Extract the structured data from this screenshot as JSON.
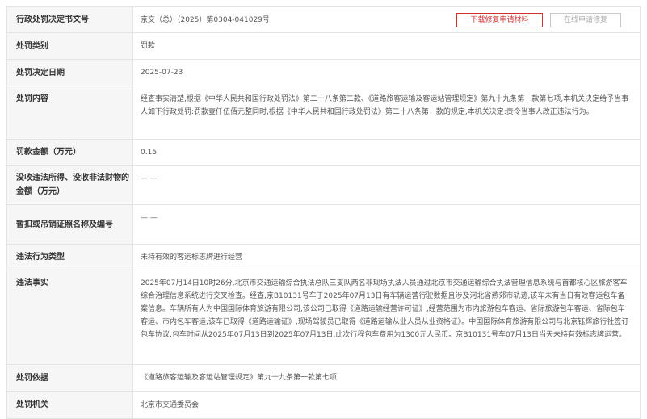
{
  "buttons": {
    "download": "下载修复申请材料",
    "online": "在线申请修复"
  },
  "rows": [
    {
      "label": "行政处罚决定书文号",
      "value": "京交（总）（2025）第0304-041029号"
    },
    {
      "label": "处罚类别",
      "value": "罚款"
    },
    {
      "label": "处罚决定日期",
      "value": "2025-07-23"
    },
    {
      "label": "处罚内容",
      "value": "经查事实清楚,根据《中华人民共和国行政处罚法》第二十八条第二款、《道路旅客运输及客运站管理规定》第九十九条第一款第七项,本机关决定给予当事人如下行政处罚:罚款壹仟伍佰元整同时,根据《中华人民共和国行政处罚法》第二十八条第一款的规定,本机关决定:责令当事人改正违法行为。"
    },
    {
      "label": "罚款金额（万元）",
      "value": "0.15"
    },
    {
      "label": "没收违法所得、没收非法财物的金额（万元）",
      "value": "— —"
    },
    {
      "label": "暂扣或吊销证照名称及编号",
      "value": "— —"
    },
    {
      "label": "违法行为类型",
      "value": "未持有效的客运标志牌进行经营"
    },
    {
      "label": "违法事实",
      "value": "2025年07月14日10时26分,北京市交通运输综合执法总队三支队两名非现场执法人员通过北京市交通运输综合执法管理信息系统与首都核心区旅游客车综合治理信息系统进行交叉检查。经查,京B10131号车于2025年07月13日有车辆运营行驶数据且涉及河北省燕郊市轨迹,该车未有当日有效客运包车备案信息。车辆所有人为中国国际体育旅游有限公司,该公司已取得《道路运输经营许可证》,经营范围为市内旅游包车客运、省际旅游包车客运、省际包车客运、市内包车客运,该车已取得《道路运输证》,现场驾驶员已取得《道路运输从业人员从业资格证》。中国国际体育旅游有限公司与北京钰辉旅行社签订包车协议,包车时间从2025年07月13日到2025年07月13日,此次行程包车费用为1300元人民币。京B10131号车07月13日当天未持有效标志牌运营。"
    },
    {
      "label": "处罚依据",
      "value": "《道路旅客运输及客运站管理规定》第九十九条第一款第七项"
    },
    {
      "label": "处罚机关",
      "value": "北京市交通委员会"
    }
  ]
}
